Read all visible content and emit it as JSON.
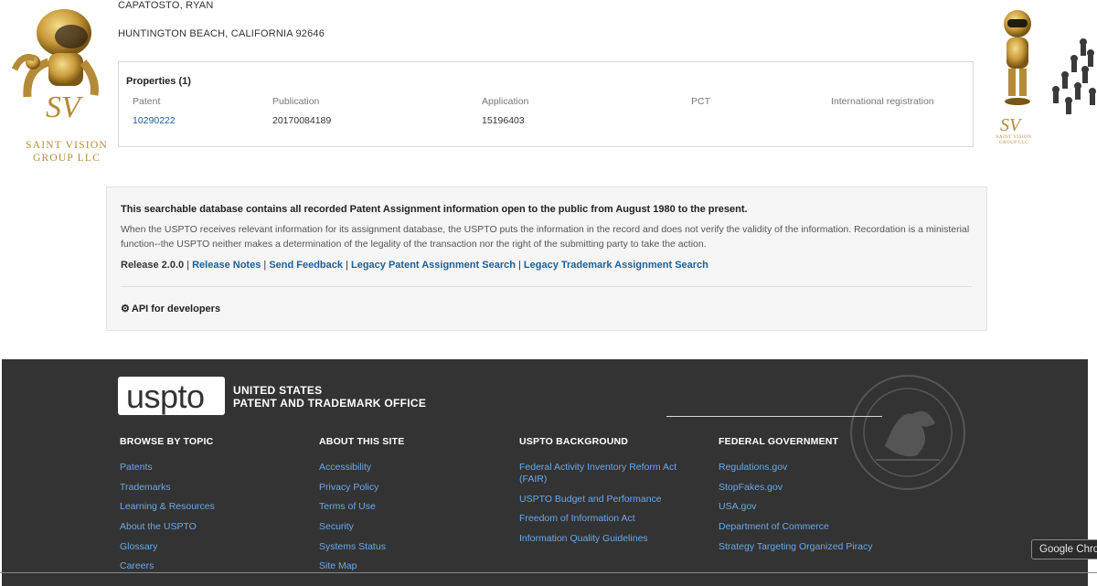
{
  "assignee": {
    "name": "CAPATOSTO, RYAN",
    "address": "HUNTINGTON BEACH, CALIFORNIA 92646"
  },
  "brand": {
    "left_text_line1": "SAINT VISION",
    "left_text_line2": "GROUP LLC",
    "left_mark": "SV",
    "right_text": "SAINT VISION GROUP LLC",
    "right_mark": "SV",
    "gold": "#b58b37"
  },
  "properties": {
    "title": "Properties (1)",
    "columns": [
      "Patent",
      "Publication",
      "Application",
      "PCT",
      "International registration"
    ],
    "row": {
      "patent": "10290222",
      "publication": "20170084189",
      "application": "15196403",
      "pct": "",
      "international": ""
    }
  },
  "info": {
    "title": "This searchable database contains all recorded Patent Assignment information open to the public from August 1980 to the present.",
    "body": "When the USPTO receives relevant information for its assignment database, the USPTO puts the information in the record and does not verify the validity of the information. Recordation is a ministerial function--the USPTO neither makes a determination of the legality of the transaction nor the right of the submitting party to take the action.",
    "release_label": "Release 2.0.0",
    "links": [
      "Release Notes",
      "Send Feedback",
      "Legacy Patent Assignment Search",
      "Legacy Trademark Assignment Search"
    ],
    "api_label": "API for developers",
    "api_icon": "gears-icon"
  },
  "footer": {
    "logo_text": "uspto",
    "agency_line1": "UNITED STATES",
    "agency_line2": "PATENT AND TRADEMARK OFFICE",
    "columns": [
      {
        "heading": "BROWSE BY TOPIC",
        "links": [
          "Patents",
          "Trademarks",
          "Learning & Resources",
          "About the USPTO",
          "Glossary",
          "Careers"
        ]
      },
      {
        "heading": "ABOUT THIS SITE",
        "links": [
          "Accessibility",
          "Privacy Policy",
          "Terms of Use",
          "Security",
          "Systems Status",
          "Site Map"
        ]
      },
      {
        "heading": "USPTO BACKGROUND",
        "links": [
          "Federal Activity Inventory Reform Act (FAIR)",
          "USPTO Budget and Performance",
          "Freedom of Information Act",
          "Information Quality Guidelines"
        ]
      },
      {
        "heading": "FEDERAL GOVERNMENT",
        "links": [
          "Regulations.gov",
          "StopFakes.gov",
          "USA.gov",
          "Department of Commerce",
          "Strategy Targeting Organized Piracy"
        ]
      }
    ],
    "background": "#333333",
    "link_color": "#6aa8e8"
  },
  "tooltip": {
    "text": "Google Chrome"
  }
}
